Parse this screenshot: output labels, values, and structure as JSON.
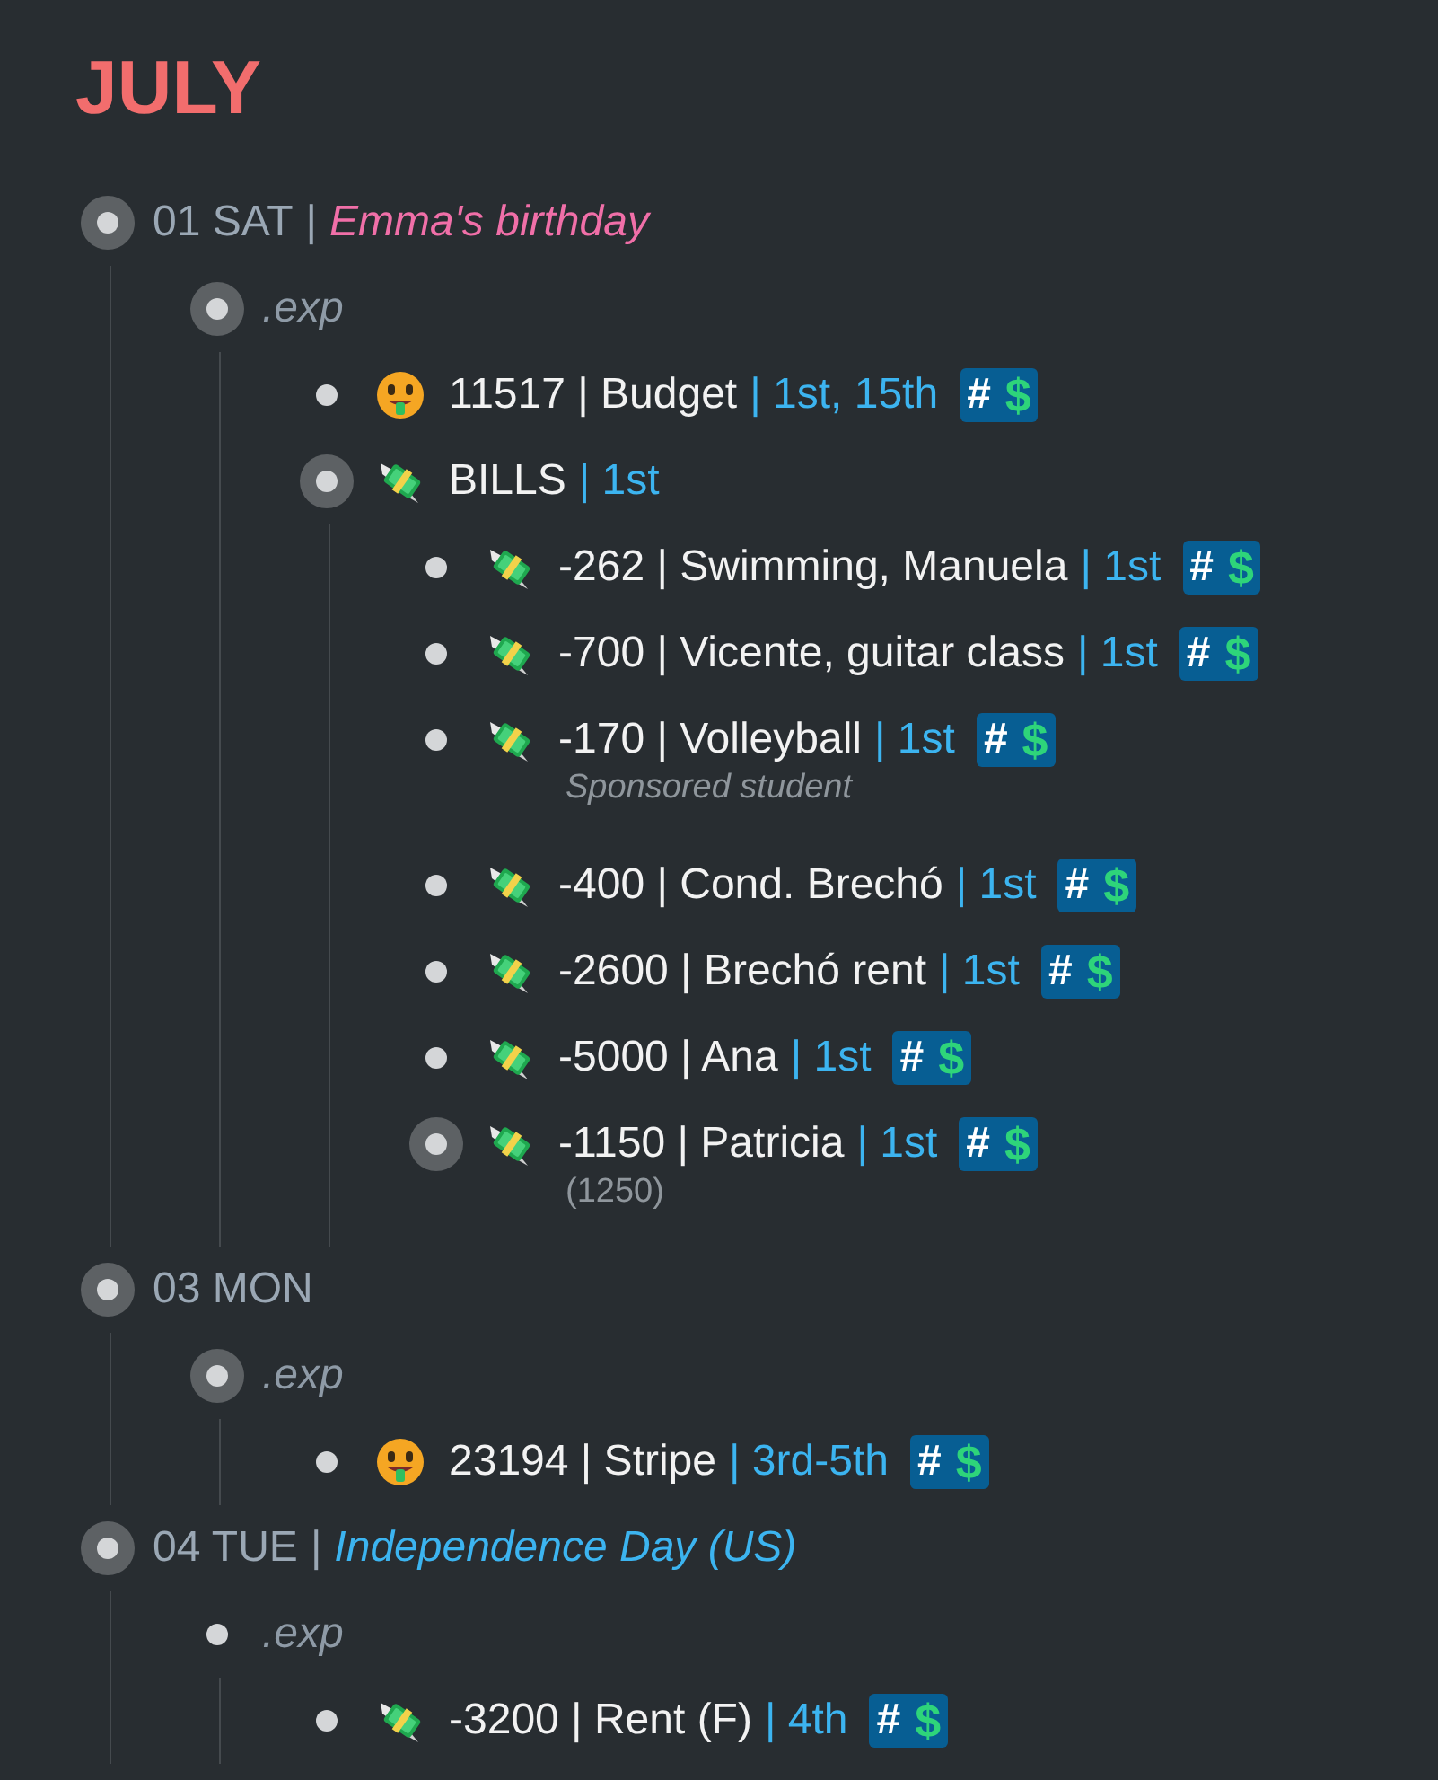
{
  "title": "JULY",
  "days": [
    {
      "kind": "day",
      "ring": true,
      "date": "01 SAT",
      "separator": "|",
      "event": {
        "text": "Emma's birthday",
        "color": "#f06fa8"
      },
      "children": [
        {
          "kind": "group",
          "ring": true,
          "text": ".exp",
          "children": [
            {
              "kind": "income",
              "ring": false,
              "label": "11517 | Budget",
              "schedule": "| 1st, 15th",
              "tag": {
                "hash": "#",
                "sign": "$"
              }
            },
            {
              "kind": "expense",
              "ring": true,
              "label": "BILLS",
              "schedule": "| 1st",
              "children": [
                {
                  "kind": "expense",
                  "ring": false,
                  "label": "-262 | Swimming, Manuela",
                  "schedule": "| 1st",
                  "tag": {
                    "hash": "#",
                    "sign": "$"
                  }
                },
                {
                  "kind": "expense",
                  "ring": false,
                  "label": "-700 | Vicente, guitar class",
                  "schedule": "| 1st",
                  "tag": {
                    "hash": "#",
                    "sign": "$"
                  }
                },
                {
                  "kind": "expense",
                  "ring": false,
                  "label": "-170 | Volleyball",
                  "schedule": "| 1st",
                  "tag": {
                    "hash": "#",
                    "sign": "$"
                  },
                  "note": {
                    "text": "Sponsored student",
                    "italic": true
                  }
                },
                {
                  "kind": "expense",
                  "ring": false,
                  "label": "-400 | Cond. Brechó",
                  "schedule": "| 1st",
                  "tag": {
                    "hash": "#",
                    "sign": "$"
                  }
                },
                {
                  "kind": "expense",
                  "ring": false,
                  "label": "-2600 | Brechó rent",
                  "schedule": "| 1st",
                  "tag": {
                    "hash": "#",
                    "sign": "$"
                  }
                },
                {
                  "kind": "expense",
                  "ring": false,
                  "label": "-5000 | Ana",
                  "schedule": "| 1st",
                  "tag": {
                    "hash": "#",
                    "sign": "$"
                  }
                },
                {
                  "kind": "expense",
                  "ring": true,
                  "label": "-1150 | Patricia",
                  "schedule": "| 1st",
                  "tag": {
                    "hash": "#",
                    "sign": "$"
                  },
                  "note": {
                    "text": "(1250)",
                    "italic": false
                  }
                }
              ]
            }
          ]
        }
      ]
    },
    {
      "kind": "day",
      "ring": true,
      "date": "03 MON",
      "children": [
        {
          "kind": "group",
          "ring": true,
          "text": ".exp",
          "children": [
            {
              "kind": "income",
              "ring": false,
              "label": "23194 | Stripe",
              "schedule": "| 3rd-5th",
              "tag": {
                "hash": "#",
                "sign": "$"
              }
            }
          ]
        }
      ]
    },
    {
      "kind": "day",
      "ring": true,
      "date": "04 TUE",
      "separator": "|",
      "event": {
        "text": "Independence Day (US)",
        "color": "#3cb4f0"
      },
      "children": [
        {
          "kind": "group",
          "ring": false,
          "text": ".exp",
          "children": [
            {
              "kind": "expense",
              "ring": false,
              "label": "-3200 | Rent (F)",
              "schedule": "| 4th",
              "tag": {
                "hash": "#",
                "sign": "$"
              }
            }
          ]
        }
      ]
    }
  ]
}
